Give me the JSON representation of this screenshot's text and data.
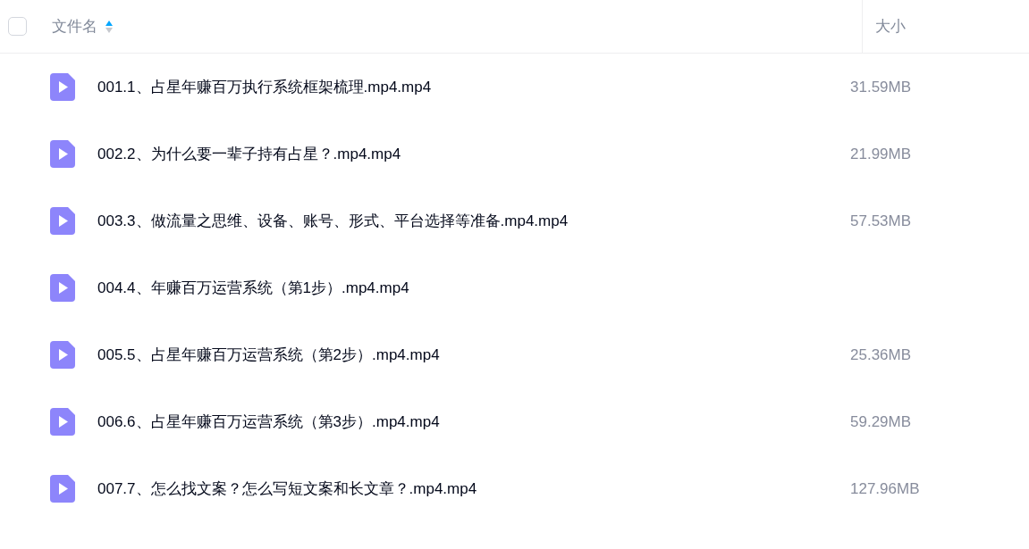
{
  "header": {
    "checked": false,
    "name_column": "文件名",
    "sort_ascending": true,
    "size_column": "大小"
  },
  "files": [
    {
      "name": "001.1、占星年赚百万执行系统框架梳理.mp4.mp4",
      "size": "31.59MB"
    },
    {
      "name": "002.2、为什么要一辈子持有占星？.mp4.mp4",
      "size": "21.99MB"
    },
    {
      "name": "003.3、做流量之思维、设备、账号、形式、平台选择等准备.mp4.mp4",
      "size": "57.53MB"
    },
    {
      "name": "004.4、年赚百万运营系统（第1步）.mp4.mp4"
    },
    {
      "name": "005.5、占星年赚百万运营系统（第2步）.mp4.mp4",
      "size": "25.36MB"
    },
    {
      "name": "006.6、占星年赚百万运营系统（第3步）.mp4.mp4",
      "size": "59.29MB"
    },
    {
      "name": "007.7、怎么找文案？怎么写短文案和长文章？.mp4.mp4",
      "size": "127.96MB"
    }
  ]
}
